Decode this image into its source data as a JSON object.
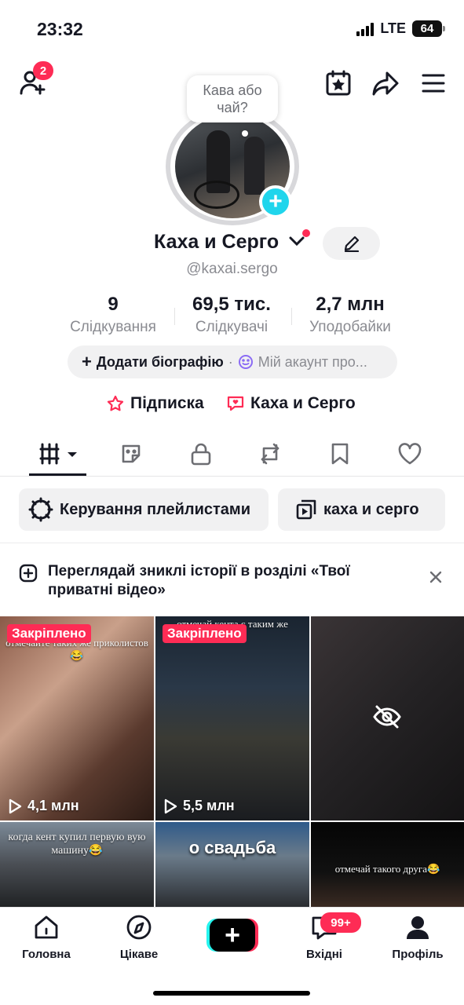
{
  "status_bar": {
    "time": "23:32",
    "network": "LTE",
    "battery": "64"
  },
  "top_bar": {
    "friends_badge": "2"
  },
  "profile": {
    "bubble_text": "Кава або чай?",
    "display_name": "Каха и Серго",
    "username": "@kaxai.sergo"
  },
  "stats": [
    {
      "value": "9",
      "label": "Слідкування"
    },
    {
      "value": "69,5 тис.",
      "label": "Слідкувачі"
    },
    {
      "value": "2,7 млн",
      "label": "Уподобайки"
    }
  ],
  "bio": {
    "add_label": "Додати біографію",
    "separator": "·",
    "account_label": "Мій акаунт про..."
  },
  "links": {
    "subscription": "Підписка",
    "friend_page": "Каха и Серго"
  },
  "playlists": {
    "manage_label": "Керування плейлистами",
    "playlist_name": "каха и серго"
  },
  "notice": {
    "text": "Переглядай зниклі історії в розділі «Твої приватні відео»"
  },
  "videos": [
    {
      "pinned": "Закріплено",
      "views": "4,1 млн",
      "caption": "отмечайте таких же приколистов😂"
    },
    {
      "pinned": "Закріплено",
      "views": "5,5 млн",
      "caption": "отмечай кента с таким же"
    },
    {
      "hidden": true
    },
    {
      "caption": "когда кент купил первую вую машину😂"
    },
    {
      "caption": "о свадьба"
    },
    {
      "caption": "отмечай такого друга😂"
    }
  ],
  "bottom_nav": {
    "home": "Головна",
    "discover": "Цікаве",
    "inbox": "Вхідні",
    "inbox_badge": "99+",
    "profile": "Профіль"
  },
  "colors": {
    "accent": "#fe2c55",
    "cyan": "#25f4ee",
    "blue_plus": "#20d5ec",
    "text": "#161823",
    "secondary": "#8a8b91"
  },
  "icons": [
    "add-friend-icon",
    "calendar-star-icon",
    "share-icon",
    "menu-icon",
    "edit-pencil-icon",
    "videos-grid-icon",
    "reposts-sticker-icon",
    "lock-icon",
    "repost-icon",
    "bookmark-icon",
    "heart-icon",
    "gear-icon",
    "playlist-icon",
    "story-icon",
    "close-icon",
    "play-icon",
    "eye-off-icon",
    "home-icon",
    "compass-icon",
    "inbox-icon",
    "profile-icon"
  ]
}
